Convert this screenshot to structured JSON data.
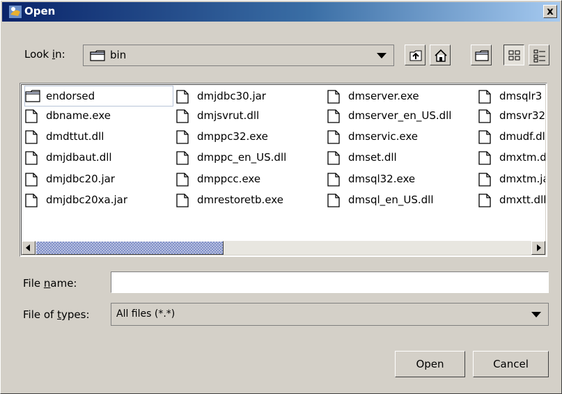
{
  "window": {
    "title": "Open",
    "close_label": "x"
  },
  "lookin": {
    "label_pre": "Look ",
    "label_mnemonic": "i",
    "label_post": "n:",
    "value": "bin"
  },
  "toolbar": {
    "up": "up-one-level-icon",
    "home": "home-icon",
    "newfolder": "new-folder-icon",
    "list": "list-view-icon",
    "details": "details-view-icon"
  },
  "files": [
    [
      "endorsed",
      "dmjdbc30.jar",
      "dmserver.exe",
      "dmsqlr3"
    ],
    [
      "dbname.exe",
      "dmjsvrut.dll",
      "dmserver_en_US.dll",
      "dmsvr32"
    ],
    [
      "dmdttut.dll",
      "dmppc32.exe",
      "dmservic.exe",
      "dmudf.dl"
    ],
    [
      "dmjdbaut.dll",
      "dmppc_en_US.dll",
      "dmset.dll",
      "dmxtm.d"
    ],
    [
      "dmjdbc20.jar",
      "dmppcc.exe",
      "dmsql32.exe",
      "dmxtm.ja"
    ],
    [
      "dmjdbc20xa.jar",
      "dmrestoretb.exe",
      "dmsql_en_US.dll",
      "dmxtt.dll"
    ]
  ],
  "filename": {
    "label_pre": "File ",
    "label_mnemonic": "n",
    "label_post": "ame:",
    "value": ""
  },
  "filetype": {
    "label_pre": "File of ",
    "label_mnemonic": "t",
    "label_post": "ypes:",
    "value": "All files (*.*)"
  },
  "buttons": {
    "open": "Open",
    "cancel": "Cancel"
  }
}
